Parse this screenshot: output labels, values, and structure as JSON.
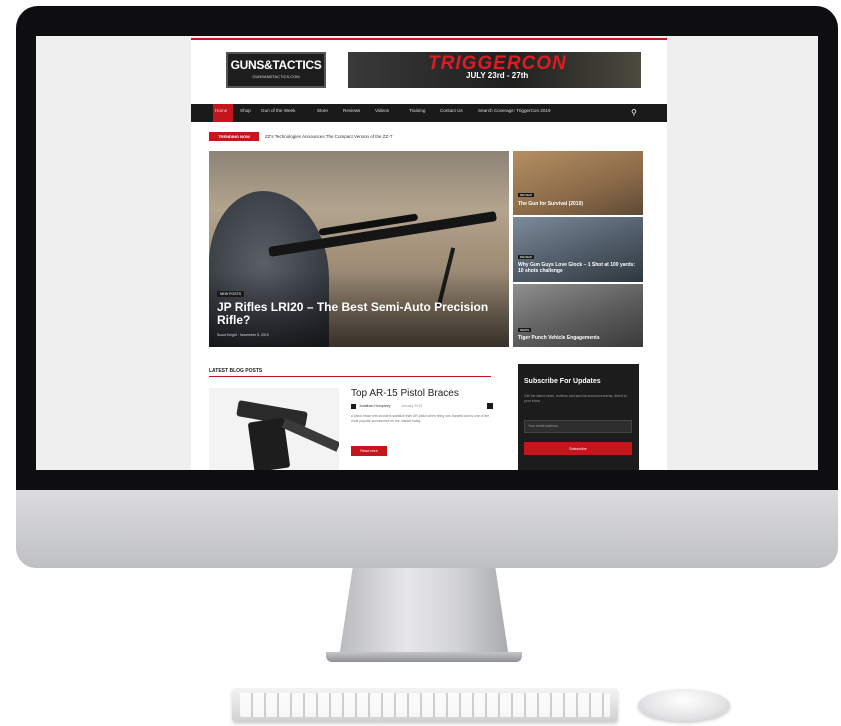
{
  "site": {
    "logo": {
      "text": "GUNS&TACTICS",
      "subtext": "GUNSANDTACTICS.COM"
    },
    "banner": {
      "title": "TRIGGERCON",
      "date": "JULY 23rd - 27th"
    },
    "nav": {
      "items": [
        "Home",
        "Shop",
        "Gun of the Week",
        "Store",
        "Reviews",
        "Videos",
        "Training",
        "Contact Us",
        "Search Coverage: TriggerCon 2019"
      ]
    },
    "trending": {
      "label": "TRENDING NOW",
      "text": "ZZ's Technologies Announces The Compact Version of the ZZ-T"
    },
    "hero": {
      "category": "NEW POSTS",
      "title": "JP Rifles LRI20 – The Best Semi-Auto Precision Rifle?",
      "meta": "Scout Knight · November 5, 2019"
    },
    "side_tiles": [
      {
        "category": "REVIEW",
        "title": "The Gun for Survival (2019)"
      },
      {
        "category": "REVIEW",
        "title": "Why Gun Guys Love Glock – 1 Shot at 100 yards: 10 shots challenge"
      },
      {
        "category": "NEWS",
        "title": "Tiger Punch Vehicle Engagements"
      }
    ],
    "latest": {
      "heading": "LATEST BLOG POSTS",
      "post": {
        "title": "Top AR-15 Pistol Braces",
        "author": "Jonathan Humphrey",
        "date": "January 2019",
        "excerpt": "A pistol brace lets shooters stabilize their AR-pistol when firing one-handed and is one of the most popular accessories on the market today.",
        "button": "Read more"
      }
    },
    "subscribe": {
      "title": "Subscribe For Updates",
      "text": "Get the latest news, reviews and special announcements, direct to your inbox",
      "placeholder": "Your email address",
      "button": "Subscribe"
    }
  }
}
